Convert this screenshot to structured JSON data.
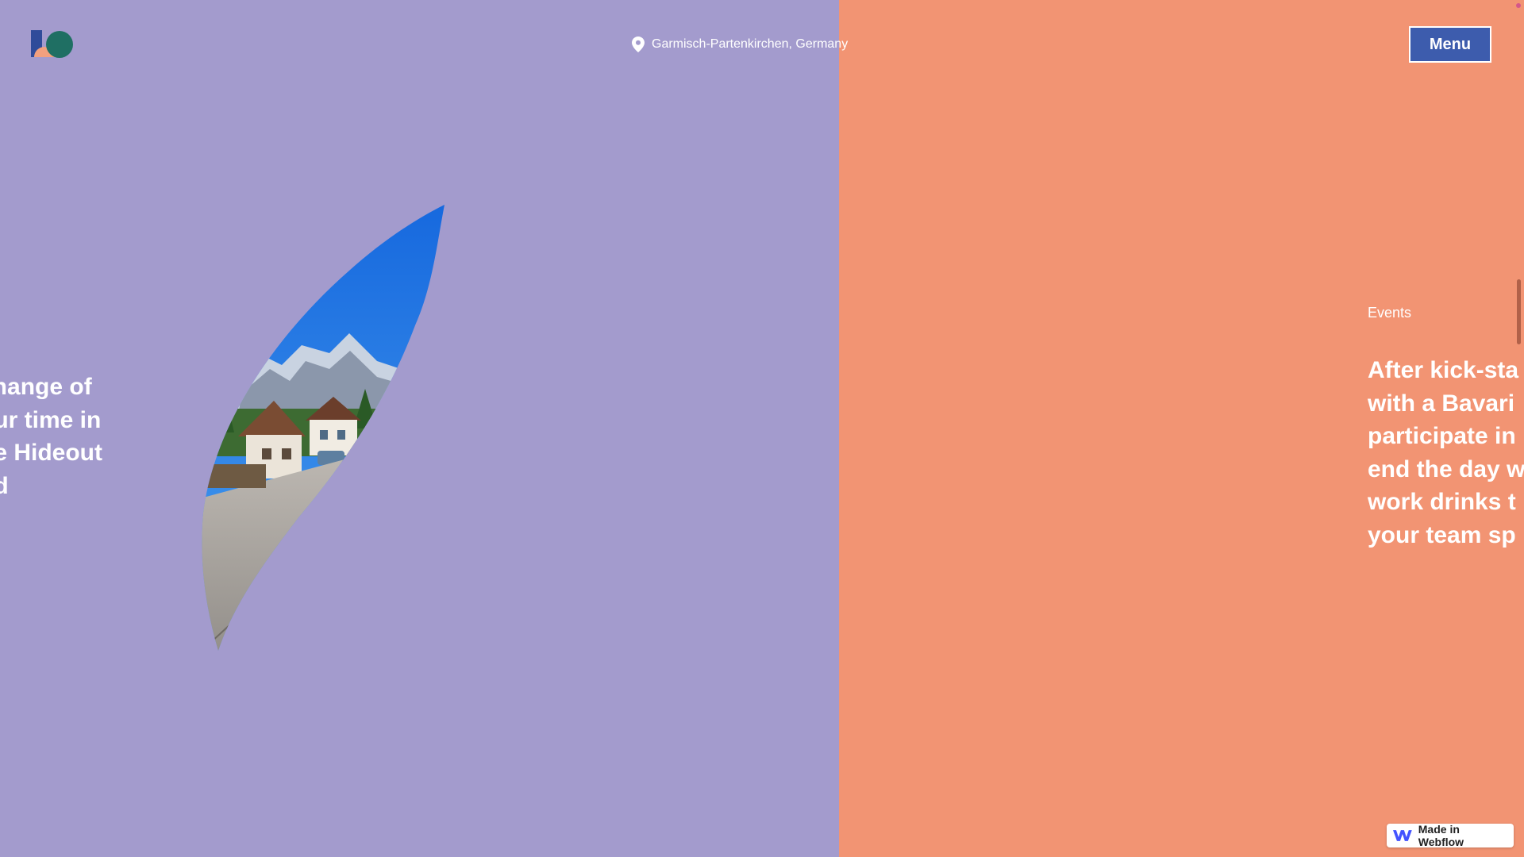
{
  "header": {
    "location_text": "Garmisch-Partenkirchen, Germany",
    "location_icon": "map-pin-icon",
    "menu_label": "Menu",
    "logo": "brand-logo"
  },
  "left_panel": {
    "bg_color": "#a39bcd",
    "intro_lines": [
      "change of",
      "our time in",
      "he Hideout",
      "nd"
    ],
    "photo": "leaf-shaped-photo-alpine-village"
  },
  "right_panel": {
    "bg_color": "#f29473",
    "section_label": "Events",
    "body_lines": [
      "After kick-sta",
      "with a Bavari",
      "participate in",
      "end the day w",
      "work drinks t",
      "your team sp"
    ]
  },
  "badge": {
    "text": "Made in Webflow",
    "icon": "webflow-logo-icon"
  },
  "colors": {
    "menu_button": "#3d5cad",
    "text": "#ffffff"
  }
}
